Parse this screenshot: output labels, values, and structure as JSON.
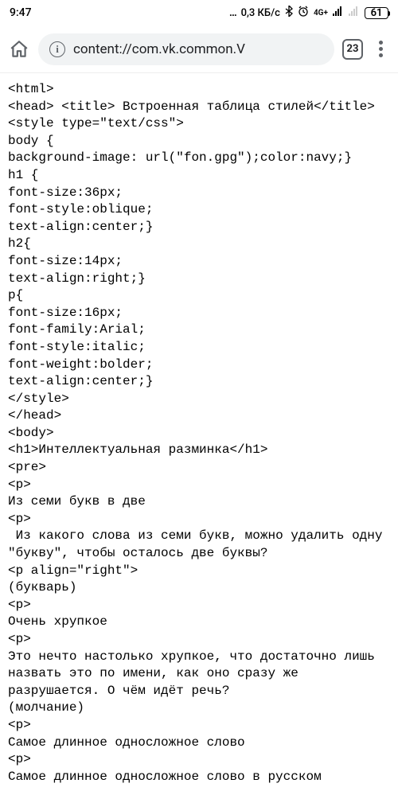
{
  "statusbar": {
    "time": "9:47",
    "data_rate": "0,3 КБ/с",
    "network_label": "4G+",
    "battery": "61"
  },
  "toolbar": {
    "url": "content://com.vk.common.V",
    "tab_count": "23"
  },
  "page_content": "<html>\n<head> <title> Встроенная таблица стилей</title>\n<style type=\"text/css\">\nbody {\nbackground-image: url(\"fon.gpg\");color:navy;}\nh1 {\nfont-size:36px;\nfont-style:oblique;\ntext-align:center;}\nh2{\nfont-size:14px;\ntext-align:right;}\np{\nfont-size:16px;\nfont-family:Arial;\nfont-style:italic;\nfont-weight:bolder;\ntext-align:center;}\n</style>\n</head>\n<body>\n<h1>Интеллектуальная разминка</h1>\n<pre>\n<p>\nИз семи букв в две\n<p>\n Из какого слова из семи букв, можно удалить одну \"букву\", чтобы осталось две буквы?\n<p align=\"right\">\n(букварь)\n<p>\nОчень хрупкое\n<p>\nЭто нечто настолько хрупкое, что достаточно лишь назвать это по имени, как оно сразу же разрушается. О чём идёт речь?\n(молчание)\n<p>\nСамое длинное односложное слово\n<p>\nСамое длинное односложное слово в русском"
}
